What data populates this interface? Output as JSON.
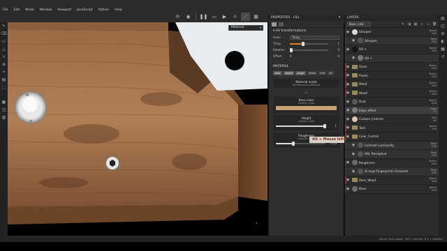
{
  "menu": [
    "File",
    "Edit",
    "Mode",
    "Window",
    "Viewport",
    "JavaScript",
    "Python",
    "Help"
  ],
  "toolbar": {
    "icons": [
      "refresh-icon",
      "camera-icon",
      "pause-icon",
      "screen-icon",
      "video-icon",
      "sun-icon",
      "wand-icon",
      "grid-icon"
    ]
  },
  "viewport": {
    "material_select": "Material"
  },
  "properties": {
    "title": "PROPERTIES - FILL",
    "uv": {
      "header": "UV transformations",
      "scale_label": "Scale",
      "scale_value": "Tiling",
      "tiling_label": "Tiling",
      "tiling_value": "1",
      "rotation_label": "Rotation",
      "rotation_value": "0",
      "offset_label": "Offset",
      "offset_value": "0",
      "offset_value2": "0"
    },
    "materials_header": "MATERIAL",
    "channels": [
      "color",
      "height",
      "rough",
      "metal",
      "nrm",
      "ao"
    ],
    "material_mode": {
      "title": "Material mode",
      "sub": "No Resource Selected"
    },
    "or_label": "Or",
    "base_color": {
      "title": "Base color",
      "sub": "uniform color",
      "swatch": "#c9a27a"
    },
    "height": {
      "title": "Height",
      "sub": "uniform color",
      "value": "1"
    },
    "roughness": {
      "title": "Roughness",
      "sub": "uniform color",
      "value": "0.33"
    }
  },
  "tooltip": "Alt + Mouse left",
  "layers": {
    "title": "LAYERS",
    "blend_select": "Base color",
    "rows": [
      {
        "name": "Sharpen",
        "blend": "Norm",
        "opacity": "100",
        "type": "fx",
        "color": "#d9d9d9"
      },
      {
        "name": "Sharpen",
        "blend": "Repl",
        "opacity": "100",
        "type": "fx-child",
        "color": "#555555"
      },
      {
        "name": "AO +",
        "blend": "Norm",
        "opacity": "100",
        "type": "layer",
        "color": "#151515"
      },
      {
        "name": "AO +",
        "blend": "",
        "opacity": "",
        "type": "mask-child",
        "color": "#777777"
      },
      {
        "name": "Glass",
        "blend": "Norm",
        "opacity": "100",
        "type": "folder",
        "color": "#8a8a8a"
      },
      {
        "name": "Plastic",
        "blend": "Norm",
        "opacity": "100",
        "type": "folder",
        "color": "#8a8a8a"
      },
      {
        "name": "Metal",
        "blend": "Norm",
        "opacity": "100",
        "type": "folder",
        "color": "#8a8a8a"
      },
      {
        "name": "Wood",
        "blend": "Norm",
        "opacity": "100",
        "type": "folder",
        "color": "#8a8a8a"
      },
      {
        "name": "Dust",
        "blend": "Norm",
        "opacity": "100",
        "type": "layer",
        "color": "#5a5a5a"
      },
      {
        "name": "Edge_effect",
        "blend": "Ligw",
        "opacity": "75",
        "type": "layer",
        "color": "#7a7a7a"
      },
      {
        "name": "Custom_Colorise",
        "blend": "Mul",
        "opacity": "90",
        "type": "layer",
        "color": "#d8c8b0"
      },
      {
        "name": "Twill",
        "blend": "Norm",
        "opacity": "100",
        "type": "folder",
        "color": "#8a8a8a"
      },
      {
        "name": "Color_Control",
        "blend": "",
        "opacity": "",
        "type": "folder",
        "color": "#8a8a8a"
      },
      {
        "name": "Contrast Luminosity",
        "blend": "Repl",
        "opacity": "100",
        "type": "fx-child",
        "color": "#555555"
      },
      {
        "name": "HSL Perceptive",
        "blend": "Repl",
        "opacity": "100",
        "type": "fx-child",
        "color": "#555555"
      },
      {
        "name": "Roughness",
        "blend": "Norm",
        "opacity": "100",
        "type": "layer",
        "color": "#6a6a6a"
      },
      {
        "name": "Grunge Fingerprints Smeared",
        "blend": "Repl",
        "opacity": "100",
        "type": "fx-child",
        "color": "#555555"
      },
      {
        "name": "Base_Wood",
        "blend": "Norm",
        "opacity": "100",
        "type": "folder",
        "color": "#8a8a8a"
      },
      {
        "name": "Base",
        "blend": "Norm",
        "opacity": "100",
        "type": "layer",
        "color": "#6d6d6d"
      }
    ]
  },
  "status": "Cache Disk Usage: 76% | Version: 8.1.1 (Steam)"
}
